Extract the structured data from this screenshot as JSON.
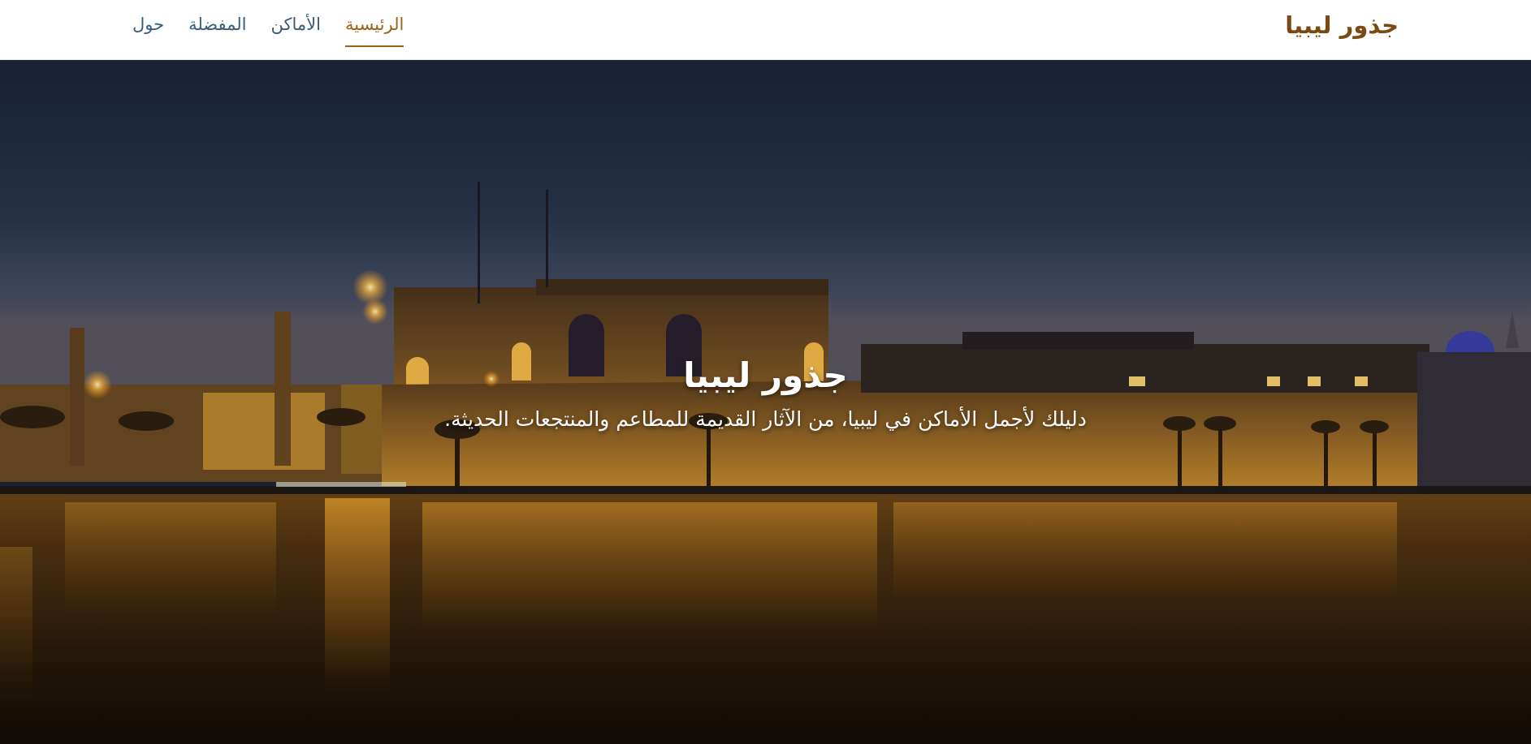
{
  "header": {
    "brand": "جذور ليبيا",
    "nav": [
      {
        "label": "الرئيسية",
        "active": true
      },
      {
        "label": "الأماكن",
        "active": false
      },
      {
        "label": "المفضلة",
        "active": false
      },
      {
        "label": "حول",
        "active": false
      }
    ]
  },
  "hero": {
    "title": "جذور ليبيا",
    "subtitle": "دليلك لأجمل الأماكن في ليبيا، من الآثار القديمة للمطاعم والمنتجعات الحديثة.",
    "background_image": "illuminated-castle-at-night-over-water"
  },
  "colors": {
    "brand": "#7a4a12",
    "nav_active": "#9a6414",
    "nav_inactive": "#3b5b7a",
    "sky_top": "#1c2638",
    "sky_horizon": "#4f566a",
    "castle_glow": "#c88a2a",
    "water": "#2a1c0e"
  },
  "icons": {
    "active_indicator": "underline-bar"
  }
}
